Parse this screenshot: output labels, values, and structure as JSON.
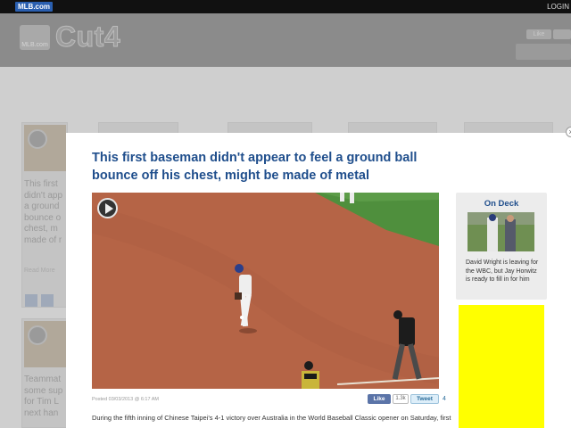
{
  "topbar": {
    "logo_text": "MLB.com",
    "logo_badge": "",
    "login_label": "LOGIN"
  },
  "header": {
    "brand_mlb_sub": "MLB.com",
    "brand_title": "Cut4",
    "like_label": "Like"
  },
  "background": {
    "card_text_lines": [
      "This first",
      "didn't app",
      "a ground",
      "bounce o",
      "chest, m",
      "made of r"
    ],
    "card_small": "Read More",
    "card2_text_lines": [
      "Teammat",
      "some sup",
      "for Tim L",
      "next han"
    ]
  },
  "modal": {
    "title": "This first baseman didn't appear to feel a ground ball bounce off his chest, might be made of metal",
    "posted": "Posted 03/03/2013 @ 6:17 AM",
    "fb_like": "Like",
    "fb_count": "1.3k",
    "tweet_label": "Tweet",
    "tweet_count": "4",
    "body": "During the fifth inning of Chinese Taipei's 4-1 victory over Australia in the World Baseball Classic opener on Saturday, first",
    "close_label": "×"
  },
  "ondeck": {
    "title": "On Deck",
    "text": "David Wright is leaving for the WBC, but Jay Horwitz is ready to fill in for him"
  },
  "colors": {
    "title_blue": "#1f4e8c",
    "ad_yellow": "#ffff00",
    "dirt": "#b7664a",
    "grass": "#4f8f3d"
  }
}
